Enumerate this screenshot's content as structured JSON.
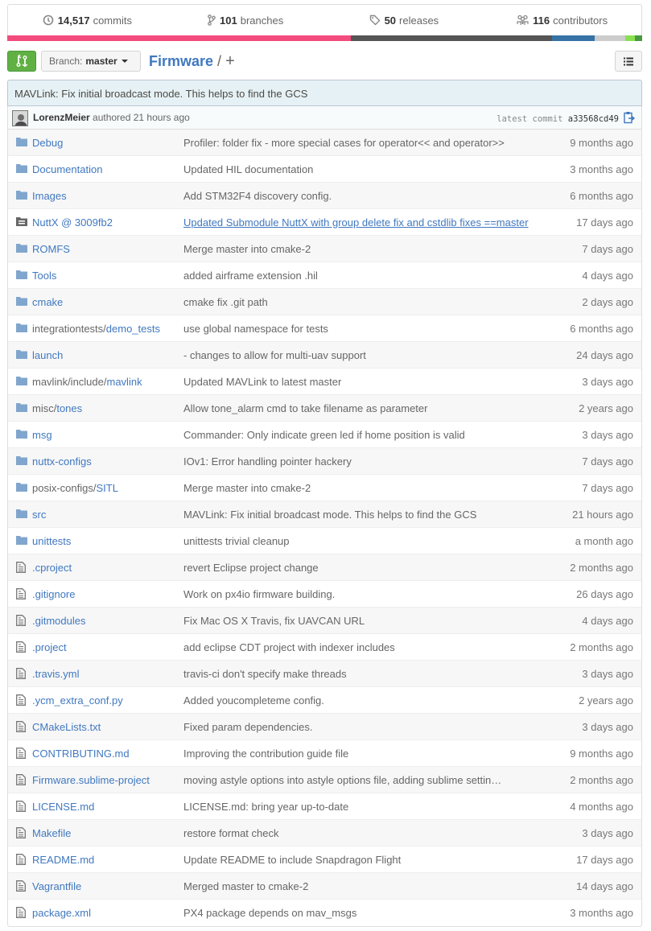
{
  "summary": {
    "commits": {
      "count": "14,517",
      "label": "commits",
      "icon": "history-icon"
    },
    "branches": {
      "count": "101",
      "label": "branches",
      "icon": "git-branch-icon"
    },
    "releases": {
      "count": "50",
      "label": "releases",
      "icon": "tag-icon"
    },
    "contributors": {
      "count": "116",
      "label": "contributors",
      "icon": "organization-icon"
    }
  },
  "language_bar": [
    {
      "color": "#f34b7d",
      "fraction": 0.541
    },
    {
      "color": "#555555",
      "fraction": 0.317
    },
    {
      "color": "#3572a5",
      "fraction": 0.067
    },
    {
      "color": "#cccccc",
      "fraction": 0.048
    },
    {
      "color": "#89e051",
      "fraction": 0.016
    },
    {
      "color": "#4a993e",
      "fraction": 0.011
    }
  ],
  "toolbar": {
    "branch_prefix": "Branch:",
    "branch_name": "master",
    "repo_name": "Firmware",
    "separator": "/",
    "add_file": "+"
  },
  "latest_commit": {
    "message": "MAVLink: Fix initial broadcast mode. This helps to find the GCS",
    "author": "LorenzMeier",
    "action": "authored",
    "time": "21 hours ago",
    "sha_label": "latest commit",
    "sha": "a33568cd49"
  },
  "colors": {
    "link": "#4078c0",
    "accent_green": "#60b044"
  },
  "files": [
    {
      "type": "dir",
      "name": "Debug",
      "message": "Profiler: folder fix - more special cases for operator<< and operator>>",
      "age": "9 months ago"
    },
    {
      "type": "dir",
      "name": "Documentation",
      "message": "Updated HIL documentation",
      "age": "3 months ago"
    },
    {
      "type": "dir",
      "name": "Images",
      "message": "Add STM32F4 discovery config.",
      "age": "6 months ago"
    },
    {
      "type": "submodule",
      "name": "NuttX @ 3009fb2",
      "message": "Updated Submodule NuttX with group delete fix and cstdlib fixes ==master",
      "age": "17 days ago"
    },
    {
      "type": "dir",
      "name": "ROMFS",
      "message": "Merge master into cmake-2",
      "age": "7 days ago"
    },
    {
      "type": "dir",
      "name": "Tools",
      "message": "added airframe extension .hil",
      "age": "4 days ago"
    },
    {
      "type": "dir",
      "name": "cmake",
      "message": "cmake fix .git path",
      "age": "2 days ago"
    },
    {
      "type": "dir",
      "name_dim": "integrationtests/",
      "name": "demo_tests",
      "message": "use global namespace for tests",
      "age": "6 months ago"
    },
    {
      "type": "dir",
      "name": "launch",
      "message": "- changes to allow for multi-uav support",
      "age": "24 days ago"
    },
    {
      "type": "dir",
      "name_dim": "mavlink/include/",
      "name": "mavlink",
      "message": "Updated MAVLink to latest master",
      "age": "3 days ago"
    },
    {
      "type": "dir",
      "name_dim": "misc/",
      "name": "tones",
      "message": "Allow tone_alarm cmd to take filename as parameter",
      "age": "2 years ago"
    },
    {
      "type": "dir",
      "name": "msg",
      "message": "Commander: Only indicate green led if home position is valid",
      "age": "3 days ago"
    },
    {
      "type": "dir",
      "name": "nuttx-configs",
      "message": "IOv1: Error handling pointer hackery",
      "age": "7 days ago"
    },
    {
      "type": "dir",
      "name_dim": "posix-configs/",
      "name": "SITL",
      "message": "Merge master into cmake-2",
      "age": "7 days ago"
    },
    {
      "type": "dir",
      "name": "src",
      "message": "MAVLink: Fix initial broadcast mode. This helps to find the GCS",
      "age": "21 hours ago"
    },
    {
      "type": "dir",
      "name": "unittests",
      "message": "unittests trivial cleanup",
      "age": "a month ago"
    },
    {
      "type": "file",
      "name": ".cproject",
      "message": "revert Eclipse project change",
      "age": "2 months ago"
    },
    {
      "type": "file",
      "name": ".gitignore",
      "message": "Work on px4io firmware building.",
      "age": "26 days ago"
    },
    {
      "type": "file",
      "name": ".gitmodules",
      "message": "Fix Mac OS X Travis, fix UAVCAN URL",
      "age": "4 days ago"
    },
    {
      "type": "file",
      "name": ".project",
      "message": "add eclipse CDT project with indexer includes",
      "age": "2 months ago"
    },
    {
      "type": "file",
      "name": ".travis.yml",
      "message": "travis-ci don't specify make threads",
      "age": "3 days ago"
    },
    {
      "type": "file",
      "name": ".ycm_extra_conf.py",
      "message": "Added youcompleteme config.",
      "age": "2 years ago"
    },
    {
      "type": "file",
      "name": "CMakeLists.txt",
      "message": "Fixed param dependencies.",
      "age": "3 days ago"
    },
    {
      "type": "file",
      "name": "CONTRIBUTING.md",
      "message": "Improving the contribution guide file",
      "age": "9 months ago"
    },
    {
      "type": "file",
      "name": "Firmware.sublime-project",
      "message": "moving astyle options into astyle options file, adding sublime settin…",
      "age": "2 months ago"
    },
    {
      "type": "file",
      "name": "LICENSE.md",
      "message": "LICENSE.md: bring year up-to-date",
      "age": "4 months ago"
    },
    {
      "type": "file",
      "name": "Makefile",
      "message": "restore format check",
      "age": "3 days ago"
    },
    {
      "type": "file",
      "name": "README.md",
      "message": "Update README to include Snapdragon Flight",
      "age": "17 days ago"
    },
    {
      "type": "file",
      "name": "Vagrantfile",
      "message": "Merged master to cmake-2",
      "age": "14 days ago"
    },
    {
      "type": "file",
      "name": "package.xml",
      "message": "PX4 package depends on mav_msgs",
      "age": "3 months ago"
    }
  ]
}
